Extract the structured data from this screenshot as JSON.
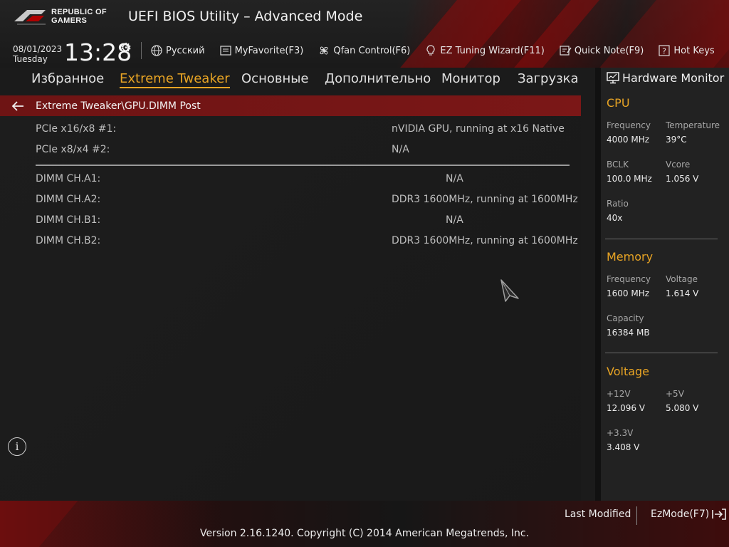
{
  "header": {
    "brand_line1": "REPUBLIC OF",
    "brand_line2": "GAMERS",
    "title": "UEFI BIOS Utility – Advanced Mode",
    "date": "08/01/2023",
    "weekday": "Tuesday",
    "time": "13:28"
  },
  "toolbar": {
    "language": "Русский",
    "myfavorite": "MyFavorite(F3)",
    "qfan": "Qfan Control(F6)",
    "ez_tuning": "EZ Tuning Wizard(F11)",
    "quick_note": "Quick Note(F9)",
    "hot_keys": "Hot Keys"
  },
  "tabs": [
    {
      "label": "Избранное",
      "active": false
    },
    {
      "label": "Extreme Tweaker",
      "active": true
    },
    {
      "label": "Основные",
      "active": false
    },
    {
      "label": "Дополнительно",
      "active": false
    },
    {
      "label": "Монитор",
      "active": false
    },
    {
      "label": "Загрузка",
      "active": false
    }
  ],
  "breadcrumb": "Extreme Tweaker\\GPU.DIMM Post",
  "main": {
    "rows": [
      {
        "label": "PCIe x16/x8 #1:",
        "value": "nVIDIA GPU, running at x16 Native"
      },
      {
        "label": "PCIe x8/x4 #2:",
        "value": "N/A"
      },
      {
        "label": "DIMM CH.A1:",
        "value": "N/A"
      },
      {
        "label": "DIMM CH.A2:",
        "value": "DDR3 1600MHz, running at 1600MHz"
      },
      {
        "label": "DIMM CH.B1:",
        "value": "N/A"
      },
      {
        "label": "DIMM CH.B2:",
        "value": "DDR3 1600MHz, running at 1600MHz"
      }
    ]
  },
  "hwmon": {
    "title": "Hardware Monitor",
    "cpu": {
      "heading": "CPU",
      "frequency_label": "Frequency",
      "frequency": "4000 MHz",
      "temperature_label": "Temperature",
      "temperature": "39°C",
      "bclk_label": "BCLK",
      "bclk": "100.0 MHz",
      "vcore_label": "Vcore",
      "vcore": "1.056 V",
      "ratio_label": "Ratio",
      "ratio": "40x"
    },
    "memory": {
      "heading": "Memory",
      "frequency_label": "Frequency",
      "frequency": "1600 MHz",
      "voltage_label": "Voltage",
      "voltage": "1.614 V",
      "capacity_label": "Capacity",
      "capacity": "16384 MB"
    },
    "voltage": {
      "heading": "Voltage",
      "v12_label": "+12V",
      "v12": "12.096 V",
      "v5_label": "+5V",
      "v5": "5.080 V",
      "v33_label": "+3.3V",
      "v33": "3.408 V"
    }
  },
  "footer": {
    "last_modified": "Last Modified",
    "ezmode": "EzMode(F7)",
    "copyright": "Version 2.16.1240. Copyright (C) 2014 American Megatrends, Inc."
  },
  "colors": {
    "accent": "#e8a424",
    "breadcrumb_bg": "#7b1717"
  },
  "icons": [
    "rog-eye-logo-icon",
    "gear-icon",
    "globe-icon",
    "favorite-list-icon",
    "fan-icon",
    "lightbulb-icon",
    "note-icon",
    "help-icon",
    "back-arrow-icon",
    "info-icon",
    "monitor-icon",
    "exit-icon",
    "mouse-cursor-icon"
  ]
}
